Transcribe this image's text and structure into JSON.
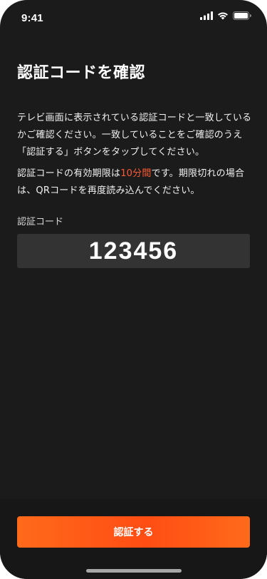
{
  "status_bar": {
    "time": "9:41",
    "icons": [
      "cellular-signal-icon",
      "wifi-icon",
      "battery-icon"
    ]
  },
  "page": {
    "title": "認証コードを確認",
    "description_1": "テレビ画面に表示されている認証コードと一致しているかご確認ください。一致していることをご確認のうえ「認証する」ボタンをタップしてください。",
    "description_2_before": "認証コードの有効期限は",
    "description_2_highlight": "10分間",
    "description_2_after": "です。期限切れの場合は、QRコードを再度読み込んでください。",
    "code_label": "認証コード",
    "code_value": "123456"
  },
  "button": {
    "label": "認証する"
  },
  "colors": {
    "background": "#1b1b1b",
    "accent": "#ff5a1a",
    "highlight_text": "#ff5a33",
    "code_box": "#333333"
  }
}
